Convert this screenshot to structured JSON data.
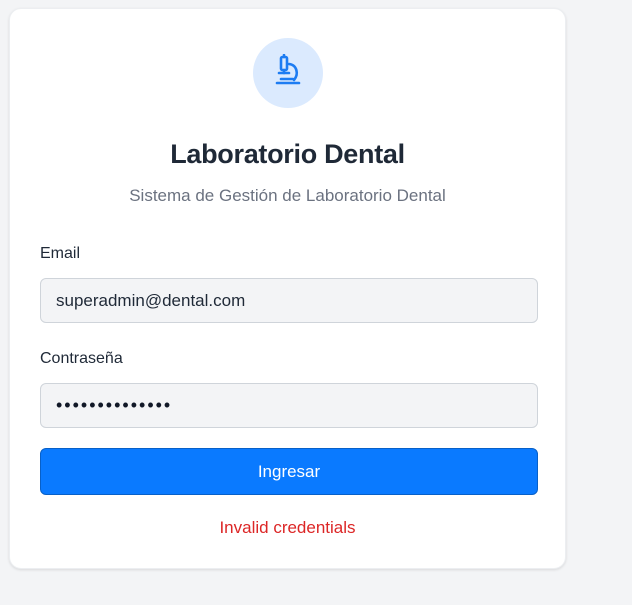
{
  "header": {
    "icon": "microscope-icon",
    "title": "Laboratorio Dental",
    "subtitle": "Sistema de Gestión de Laboratorio Dental"
  },
  "form": {
    "email_label": "Email",
    "email_value": "superadmin@dental.com",
    "password_label": "Contraseña",
    "password_value": "••••••••••••••",
    "submit_label": "Ingresar",
    "error_message": "Invalid credentials"
  },
  "colors": {
    "primary": "#0a7aff",
    "icon_bg": "#dbeafe",
    "error": "#dc2626",
    "page_bg": "#f3f4f6"
  }
}
